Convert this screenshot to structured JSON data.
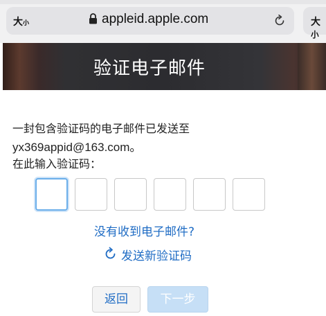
{
  "browser": {
    "text_size_label": "大",
    "text_size_small": "小",
    "url": "appleid.apple.com",
    "right_tab_label": "大",
    "right_tab_small": "小"
  },
  "banner": {
    "title": "验证电子邮件"
  },
  "content": {
    "instruction_line1": "一封包含验证码的电子邮件已发送至",
    "email": "yx369appid@163.com。",
    "prompt": "在此输入验证码："
  },
  "code_inputs": [
    "",
    "",
    "",
    "",
    "",
    ""
  ],
  "links": {
    "not_received": "没有收到电子邮件?",
    "resend": "发送新验证码"
  },
  "buttons": {
    "back": "返回",
    "next": "下一步"
  },
  "colors": {
    "link": "#1f6cc4",
    "active_border": "#6aaeea",
    "next_disabled_bg": "#c6dff6"
  },
  "icons": [
    "lock-icon",
    "reload-icon",
    "resend-icon"
  ]
}
